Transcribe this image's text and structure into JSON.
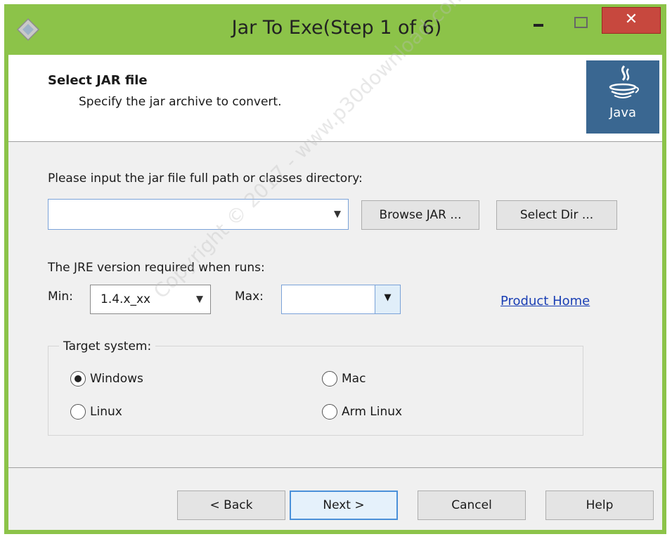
{
  "window": {
    "title": "Jar To Exe(Step 1 of 6)",
    "close_glyph": "✕"
  },
  "header": {
    "title": "Select JAR file",
    "subtitle": "Specify the jar archive to convert.",
    "logo_text": "Java"
  },
  "jar_input": {
    "label": "Please input the jar file full path or classes directory:",
    "value": "",
    "browse_label": "Browse JAR ...",
    "selectdir_label": "Select Dir ..."
  },
  "jre": {
    "label": "The JRE version required when runs:",
    "min_label": "Min:",
    "min_value": "1.4.x_xx",
    "max_label": "Max:",
    "max_value": ""
  },
  "product_home": "Product Home",
  "target": {
    "title": "Target system:",
    "options": [
      {
        "label": "Windows",
        "checked": true
      },
      {
        "label": "Mac",
        "checked": false
      },
      {
        "label": "Linux",
        "checked": false
      },
      {
        "label": "Arm Linux",
        "checked": false
      }
    ]
  },
  "footer": {
    "back_label": "< Back",
    "next_label": "Next >",
    "cancel_label": "Cancel",
    "help_label": "Help"
  },
  "watermark": "Copyright © 2017 - www.p30download.com",
  "colors": {
    "frame": "#8cc349",
    "close": "#c7483e",
    "link": "#1a3fb4",
    "java_logo": "#3a6791"
  }
}
